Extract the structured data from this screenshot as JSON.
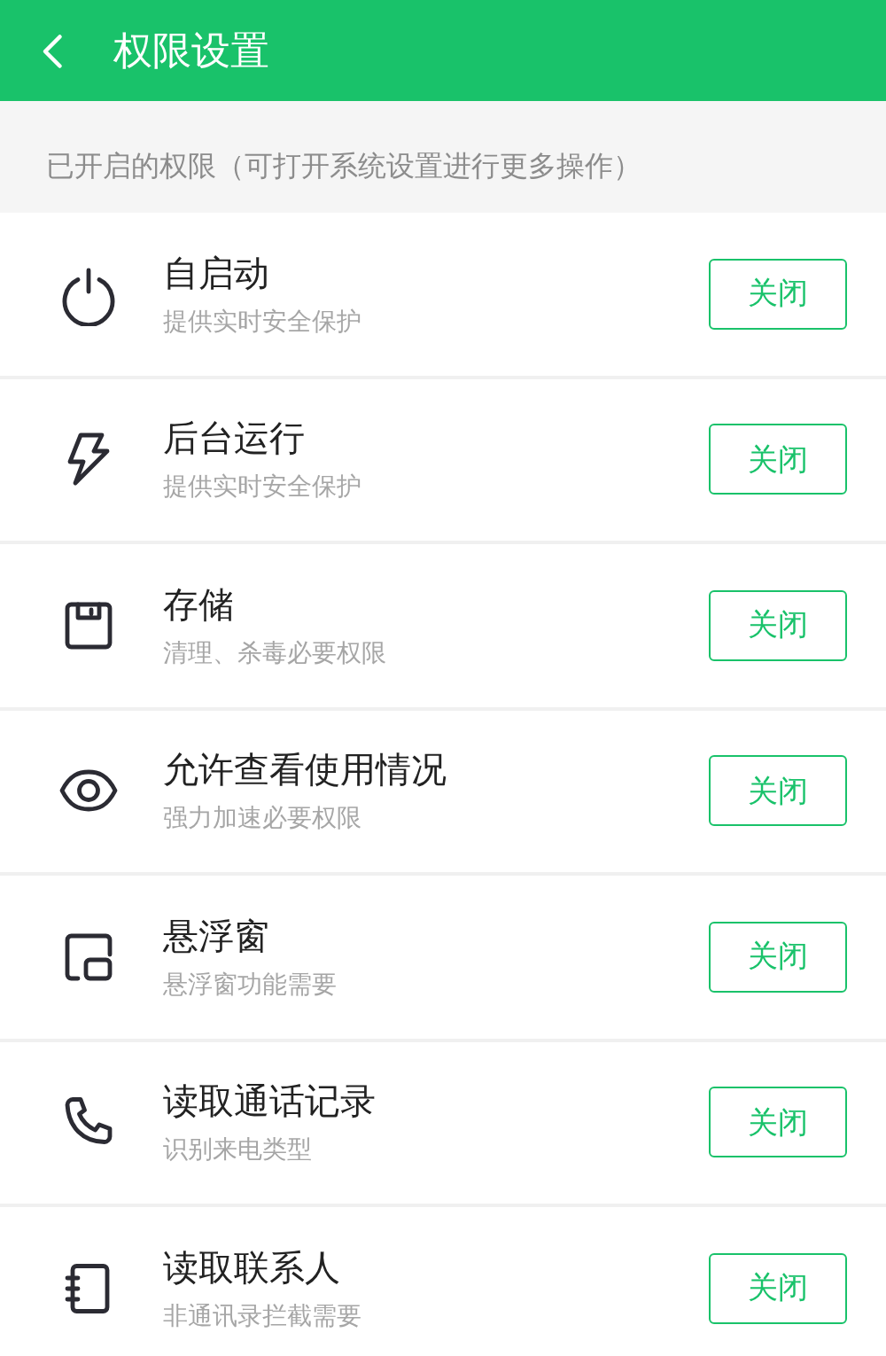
{
  "header": {
    "title": "权限设置"
  },
  "section": {
    "title": "已开启的权限（可打开系统设置进行更多操作）"
  },
  "permissions": [
    {
      "name": "自启动",
      "description": "提供实时安全保护",
      "button": "关闭"
    },
    {
      "name": "后台运行",
      "description": "提供实时安全保护",
      "button": "关闭"
    },
    {
      "name": "存储",
      "description": "清理、杀毒必要权限",
      "button": "关闭"
    },
    {
      "name": "允许查看使用情况",
      "description": "强力加速必要权限",
      "button": "关闭"
    },
    {
      "name": "悬浮窗",
      "description": "悬浮窗功能需要",
      "button": "关闭"
    },
    {
      "name": "读取通话记录",
      "description": "识别来电类型",
      "button": "关闭"
    },
    {
      "name": "读取联系人",
      "description": "非通讯录拦截需要",
      "button": "关闭"
    }
  ]
}
